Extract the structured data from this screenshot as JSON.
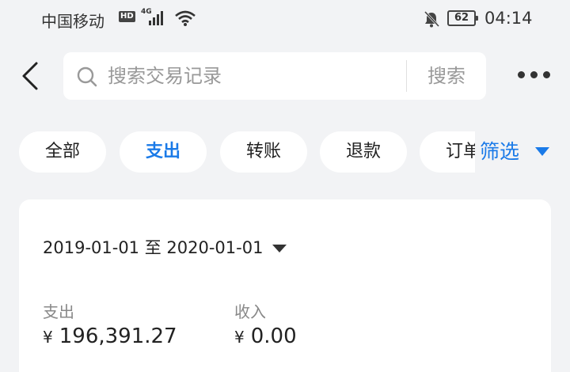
{
  "status_bar": {
    "carrier": "中国移动",
    "hd": "HD",
    "network": "4G",
    "battery": "62",
    "time": "04:14"
  },
  "header": {
    "search_placeholder": "搜索交易记录",
    "search_button": "搜索"
  },
  "tabs": [
    {
      "label": "全部",
      "active": false
    },
    {
      "label": "支出",
      "active": true
    },
    {
      "label": "转账",
      "active": false
    },
    {
      "label": "退款",
      "active": false
    },
    {
      "label": "订单",
      "active": false
    }
  ],
  "filter": {
    "label": "筛选"
  },
  "summary": {
    "date_range": "2019-01-01 至 2020-01-01",
    "expense_label": "支出",
    "expense_currency": "¥",
    "expense_value": "196,391.27",
    "income_label": "收入",
    "income_currency": "¥",
    "income_value": "0.00"
  },
  "colors": {
    "accent": "#1a7ae8",
    "background": "#f2f3f5",
    "card": "#ffffff"
  }
}
